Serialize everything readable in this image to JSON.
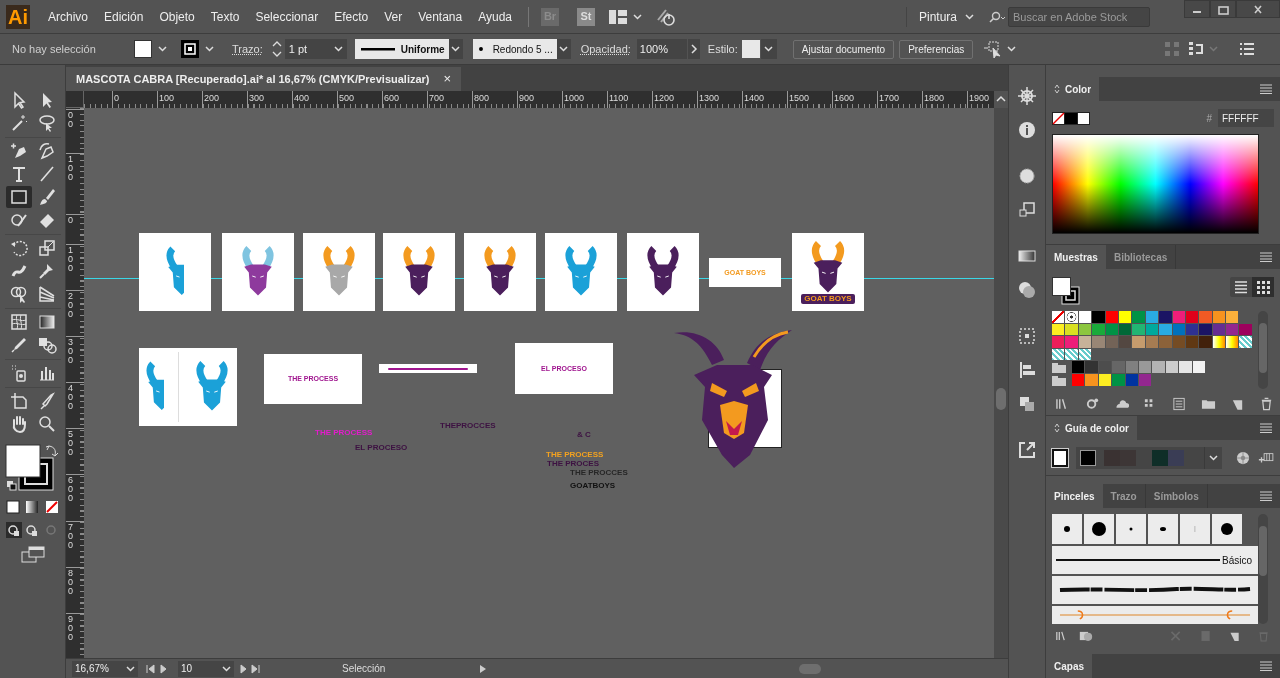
{
  "app": {
    "logo": "Ai",
    "bridge": "Br",
    "stock": "St",
    "workspace": "Pintura",
    "search": {
      "placeholder": "Buscar en Adobe Stock"
    }
  },
  "menu": [
    "Archivo",
    "Edición",
    "Objeto",
    "Texto",
    "Seleccionar",
    "Efecto",
    "Ver",
    "Ventana",
    "Ayuda"
  ],
  "control_bar": {
    "selection": "No hay selección",
    "stroke_label": "Trazo:",
    "stroke_weight": "1 pt",
    "profile": "Uniforme",
    "brush": "Redondo 5 ...",
    "opacity_label": "Opacidad:",
    "opacity": "100%",
    "style_label": "Estilo:",
    "buttons": [
      "Ajustar documento",
      "Preferencias"
    ]
  },
  "document_tab": {
    "title": "MASCOTA CABRA [Recuperado].ai* al 16,67% (CMYK/Previsualizar)",
    "close": "×"
  },
  "ruler": {
    "horizontal": [
      "0",
      "100",
      "200",
      "300",
      "400",
      "500",
      "600",
      "700",
      "800",
      "900",
      "1000",
      "1100",
      "1200",
      "1300",
      "1400",
      "1500",
      "1600",
      "1700",
      "1800",
      "1900"
    ],
    "vertical": [
      "00",
      "100",
      "0",
      "100",
      "200",
      "300",
      "400",
      "500",
      "600",
      "700",
      "800",
      "900"
    ]
  },
  "tools": [
    {
      "kind": "select",
      "selected": false
    },
    {
      "kind": "direct",
      "selected": false
    },
    {
      "kind": "wand",
      "selected": false
    },
    {
      "kind": "lasso",
      "selected": false
    },
    {
      "kind": "pen",
      "selected": false
    },
    {
      "kind": "curvature",
      "selected": false
    },
    {
      "kind": "type",
      "selected": false
    },
    {
      "kind": "line",
      "selected": false
    },
    {
      "kind": "rectangle",
      "selected": true
    },
    {
      "kind": "brush",
      "selected": false
    },
    {
      "kind": "shaper",
      "selected": false
    },
    {
      "kind": "eraser",
      "selected": false
    },
    {
      "kind": "rotate",
      "selected": false
    },
    {
      "kind": "scale",
      "selected": false
    },
    {
      "kind": "warp",
      "selected": false
    },
    {
      "kind": "pin",
      "selected": false
    },
    {
      "kind": "shapebuilder",
      "selected": false
    },
    {
      "kind": "perspective",
      "selected": false
    },
    {
      "kind": "mesh",
      "selected": false
    },
    {
      "kind": "gradient",
      "selected": false
    },
    {
      "kind": "eyedropper",
      "selected": false
    },
    {
      "kind": "blend",
      "selected": false
    },
    {
      "kind": "sprayer",
      "selected": false
    },
    {
      "kind": "graph",
      "selected": false
    },
    {
      "kind": "artboard",
      "selected": false
    },
    {
      "kind": "knife",
      "selected": false
    },
    {
      "kind": "hand",
      "selected": false
    },
    {
      "kind": "zoom",
      "selected": false
    }
  ],
  "canvas": {
    "artboards": [
      {
        "kind": "goat",
        "color": "#1ba1d8",
        "horns": {
          "color": "#1ba1d8"
        }
      },
      {
        "kind": "goat",
        "color": "#8e3a9d",
        "horns": {
          "color": "#7fc4e0"
        }
      },
      {
        "kind": "goat",
        "color": "#a8a8a8",
        "horns": {
          "color": "#f39a1f"
        }
      },
      {
        "kind": "goat",
        "color": "#4b1f5c",
        "horns": {
          "color": "#f39a1f"
        }
      },
      {
        "kind": "goat",
        "color": "#4b1f5c",
        "horns": {
          "color": "#f39a1f"
        }
      },
      {
        "kind": "goat",
        "color": "#1ba1d8",
        "horns": {
          "color": "#1ba1d8"
        }
      },
      {
        "kind": "goat",
        "color": "#4b1f5c",
        "horns": {
          "color": "#4b1f5c"
        }
      },
      {
        "kind": "text",
        "text": "GOAT BOYS",
        "color": "#f39a1f"
      },
      {
        "kind": "logo",
        "text": "GOAT BOYS",
        "color": "#4b1f5c",
        "horns": {
          "color": "#f39a1f"
        }
      },
      {
        "kind": "pair",
        "color": "#1ba1d8",
        "horns": {
          "color": "#1ba1d8"
        }
      },
      {
        "kind": "text",
        "text": "THE PROCESS",
        "color": "#a0168f"
      },
      {
        "kind": "line",
        "color": "#a0168f"
      },
      {
        "kind": "text",
        "text": "EL PROCESO",
        "color": "#a0168f"
      }
    ],
    "mascot": {
      "color": "#4b1f5c",
      "horns": {
        "color": "#f39a1f"
      }
    },
    "texts": [
      {
        "text": "THE PROCESS",
        "color": "#e21ccb"
      },
      {
        "text": "EL PROCESO",
        "color": "#3d1142"
      },
      {
        "text": "THEPROCCES",
        "color": "#3d1142"
      },
      {
        "text": "& C",
        "color": "#3d1142"
      },
      {
        "text": "THE PROCESS",
        "color": "#f3a21f"
      },
      {
        "text": "THE PROCES",
        "color": "#3d1142"
      },
      {
        "text": "THE PROCCES",
        "color": "#262626"
      },
      {
        "text": "GOATBOYS",
        "color": "#111111"
      }
    ]
  },
  "status_bar": {
    "zoom": "16,67%",
    "artboard": "10",
    "tool": "Selección"
  },
  "color_panel": {
    "title": "Color",
    "hash": "#",
    "hex": "FFFFFF"
  },
  "swatches_panel": {
    "tabs": [
      {
        "label": "Muestras",
        "selected": true
      },
      {
        "label": "Bibliotecas",
        "selected": false
      }
    ],
    "rows": [
      [
        {
          "kind": "none"
        },
        {
          "kind": "registration"
        },
        {
          "kind": "solid",
          "color": "#ffffff"
        },
        {
          "kind": "solid",
          "color": "#000000"
        },
        {
          "kind": "solid",
          "color": "#ff0000"
        },
        {
          "kind": "solid",
          "color": "#ffff00"
        },
        {
          "kind": "solid",
          "color": "#009245"
        },
        {
          "kind": "solid",
          "color": "#29abe2"
        },
        {
          "kind": "solid",
          "color": "#1b1464"
        },
        {
          "kind": "solid",
          "color": "#ed1e79"
        },
        {
          "kind": "solid",
          "color": "#e1001a"
        },
        {
          "kind": "solid",
          "color": "#f15a24"
        },
        {
          "kind": "solid",
          "color": "#f7931e"
        },
        {
          "kind": "solid",
          "color": "#fbb03b"
        }
      ],
      [
        {
          "kind": "solid",
          "color": "#fcee21"
        },
        {
          "kind": "solid",
          "color": "#d9e021"
        },
        {
          "kind": "solid",
          "color": "#8cc63f"
        },
        {
          "kind": "solid",
          "color": "#1aaa3a"
        },
        {
          "kind": "solid",
          "color": "#009245"
        },
        {
          "kind": "solid",
          "color": "#006837"
        },
        {
          "kind": "solid",
          "color": "#22b573"
        },
        {
          "kind": "solid",
          "color": "#00a99d"
        },
        {
          "kind": "solid",
          "color": "#29abe2"
        },
        {
          "kind": "solid",
          "color": "#0071bc"
        },
        {
          "kind": "solid",
          "color": "#2e3192"
        },
        {
          "kind": "solid",
          "color": "#1b1464"
        },
        {
          "kind": "solid",
          "color": "#662d91"
        },
        {
          "kind": "solid",
          "color": "#93278f"
        },
        {
          "kind": "solid",
          "color": "#9e005d"
        }
      ],
      [
        {
          "kind": "solid",
          "color": "#ed1e5a"
        },
        {
          "kind": "solid",
          "color": "#ed1e79"
        },
        {
          "kind": "solid",
          "color": "#c7b299"
        },
        {
          "kind": "solid",
          "color": "#998675"
        },
        {
          "kind": "solid",
          "color": "#736357"
        },
        {
          "kind": "solid",
          "color": "#534741"
        },
        {
          "kind": "solid",
          "color": "#c69c6d"
        },
        {
          "kind": "solid",
          "color": "#a67c52"
        },
        {
          "kind": "solid",
          "color": "#8c6239"
        },
        {
          "kind": "solid",
          "color": "#754c24"
        },
        {
          "kind": "solid",
          "color": "#603813"
        },
        {
          "kind": "solid",
          "color": "#42210b"
        },
        {
          "kind": "gradient"
        },
        {
          "kind": "gradient"
        },
        {
          "kind": "pattern"
        }
      ],
      [
        {
          "kind": "pattern"
        },
        {
          "kind": "pattern"
        },
        {
          "kind": "pattern"
        }
      ],
      [
        {
          "kind": "folder"
        },
        {
          "kind": "solid",
          "color": "#000000"
        },
        {
          "kind": "solid",
          "color": "#333333"
        },
        {
          "kind": "solid",
          "color": "#4d4d4d"
        },
        {
          "kind": "solid",
          "color": "#666666"
        },
        {
          "kind": "solid",
          "color": "#808080"
        },
        {
          "kind": "solid",
          "color": "#999999"
        },
        {
          "kind": "solid",
          "color": "#b3b3b3"
        },
        {
          "kind": "solid",
          "color": "#cccccc"
        },
        {
          "kind": "solid",
          "color": "#e6e6e6"
        },
        {
          "kind": "solid",
          "color": "#f2f2f2"
        }
      ],
      [
        {
          "kind": "folder"
        },
        {
          "kind": "solid",
          "color": "#ff0000"
        },
        {
          "kind": "solid",
          "color": "#f7931e"
        },
        {
          "kind": "solid",
          "color": "#fcee21"
        },
        {
          "kind": "solid",
          "color": "#009245"
        },
        {
          "kind": "solid",
          "color": "#0033a0"
        },
        {
          "kind": "solid",
          "color": "#93278f"
        }
      ]
    ]
  },
  "color_guide": {
    "title": "Guía de color",
    "colors": [
      {
        "color": "#000000"
      },
      {
        "color": "#3a3232"
      },
      {
        "color": "#3d3636"
      },
      {
        "color": "#0f2e28"
      },
      {
        "color": "#3a3d55"
      }
    ]
  },
  "brushes_panel": {
    "tabs": [
      {
        "label": "Pinceles",
        "selected": true
      },
      {
        "label": "Trazo",
        "selected": false
      },
      {
        "label": "Símbolos",
        "selected": false
      }
    ],
    "basic": "Básico"
  },
  "layers_panel": {
    "title": "Capas"
  }
}
